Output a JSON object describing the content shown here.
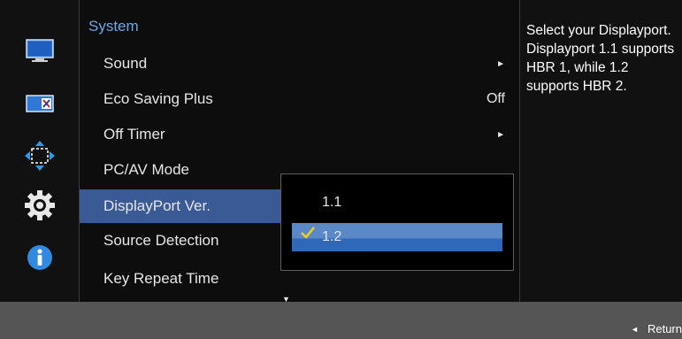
{
  "menu": {
    "title": "System",
    "items": [
      {
        "label": "Sound",
        "value": "",
        "arrow": "►"
      },
      {
        "label": "Eco Saving Plus",
        "value": "Off",
        "arrow": ""
      },
      {
        "label": "Off Timer",
        "value": "",
        "arrow": "►"
      },
      {
        "label": "PC/AV Mode",
        "value": "",
        "arrow": ""
      },
      {
        "label": "DisplayPort Ver.",
        "value": "",
        "arrow": ""
      },
      {
        "label": "Source Detection",
        "value": "",
        "arrow": ""
      },
      {
        "label": "Key Repeat Time",
        "value": "",
        "arrow": ""
      }
    ],
    "selected_item": "DisplayPort Ver.",
    "more_indicator": "▼"
  },
  "submenu": {
    "options": [
      {
        "label": "1.1"
      },
      {
        "label": "1.2"
      }
    ],
    "selected_option": "1.2"
  },
  "help_text": "Select your Displayport. Displayport 1.1 supports HBR 1, while 1.2 supports HBR 2.",
  "footer": {
    "return_arrow": "◄",
    "return_label": "Return"
  },
  "rail_icons": [
    "picture-icon",
    "screen-adjust-icon",
    "position-icon",
    "system-gear-icon",
    "information-icon"
  ],
  "colors": {
    "accent_title": "#6aa8e8",
    "selected_item_bg": "#3a5a95",
    "selected_option_bg": "#4d7fc2",
    "check": "#f2d21a",
    "footer_bg": "#555555"
  }
}
